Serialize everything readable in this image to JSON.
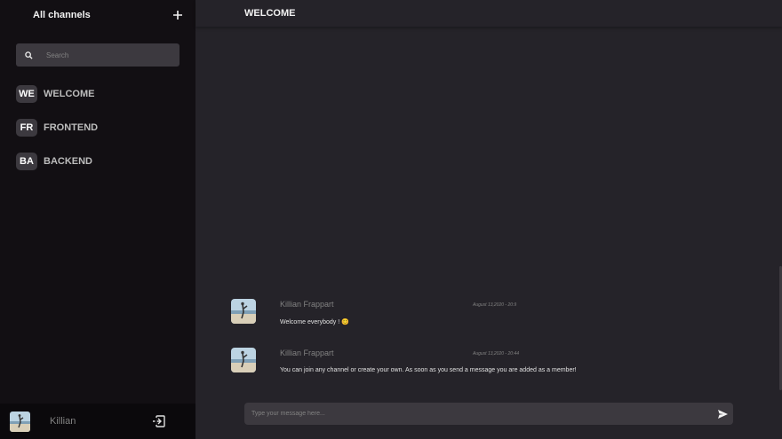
{
  "sidebar": {
    "title": "All channels",
    "add_icon": "plus-icon",
    "search": {
      "placeholder": "Search",
      "value": "",
      "icon": "search-icon"
    },
    "channels": [
      {
        "badge": "WE",
        "name": "WELCOME"
      },
      {
        "badge": "FR",
        "name": "FRONTEND"
      },
      {
        "badge": "BA",
        "name": "BACKEND"
      }
    ],
    "user": {
      "name": "Killian",
      "logout_icon": "logout-icon"
    }
  },
  "main": {
    "channel_title": "WELCOME",
    "messages": [
      {
        "author": "Killian Frappart",
        "time": "August 13,2020 - 20:9",
        "text": "Welcome everybody ! 😊"
      },
      {
        "author": "Killian Frappart",
        "time": "August 13,2020 - 20:44",
        "text": "You can join any channel or create your own. As soon as you send a message you are added as a member!"
      }
    ],
    "composer": {
      "placeholder": "Type your message here...",
      "value": "",
      "send_icon": "send-icon"
    }
  },
  "colors": {
    "sidebar_bg": "#120f13",
    "main_bg": "#252329",
    "input_bg": "#3c393f",
    "muted_text": "#828282"
  }
}
